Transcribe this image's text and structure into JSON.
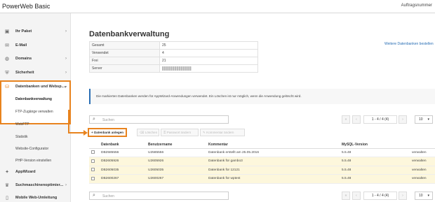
{
  "app": {
    "title": "PowerWeb Basic",
    "order_label": "Auftragsnummer"
  },
  "sidebar": {
    "items": [
      {
        "icon": "package-icon",
        "label": "Ihr Paket"
      },
      {
        "icon": "mail-icon",
        "label": "E-Mail"
      },
      {
        "icon": "globe-icon",
        "label": "Domains"
      },
      {
        "icon": "shield-icon",
        "label": "Sicherheit"
      },
      {
        "icon": "database-icon",
        "label": "Datenbanken und Websp..."
      },
      {
        "icon": "wizard-icon",
        "label": "AppWizard"
      },
      {
        "icon": "trophy-icon",
        "label": "Suchmaschinenoptimier..."
      },
      {
        "icon": "mobile-icon",
        "label": "Mobile Web-Umleitung"
      }
    ],
    "sub_items": [
      "Datenbankverwaltung",
      "FTP-Zugänge verwalten",
      "WebFTP",
      "Statistik",
      "Website-Configurator",
      "PHP-Version einstellen"
    ]
  },
  "main": {
    "title": "Datenbankverwaltung",
    "more_link": "Weitere Datenbanken bestellen",
    "stats": [
      {
        "label": "Gesamt",
        "value": "25"
      },
      {
        "label": "Verwendet",
        "value": "4"
      },
      {
        "label": "Frei",
        "value": "21"
      },
      {
        "label": "Server",
        "value": ""
      }
    ],
    "notice": "Die markierten Datenbanken werden für AppWizard-Anwendungen verwendet. Ein Löschen ist nur möglich, wenn die Anwendung gelöscht wird.",
    "search_placeholder": "Suchen",
    "pager_info": "1 - 4 / 4 (4)",
    "page_size": "10",
    "actions": {
      "create": "Datenbank anlegen",
      "delete": "Löschen",
      "reset_password": "Passwort ändern",
      "edit_comment": "Kommentar ändern"
    },
    "table": {
      "columns": [
        "",
        "Datenbank",
        "Benutzername",
        "Kommentar",
        "MySQL-Version",
        ""
      ],
      "rows": [
        {
          "db": "DB2585556",
          "user": "U2585556",
          "comment": "Datenbank erstellt am 25.05.2016",
          "version": "5.5.48",
          "action": "verwalten",
          "highlight": false
        },
        {
          "db": "DB2605926",
          "user": "U2605926",
          "comment": "Datenbank für gambo3",
          "version": "5.5.48",
          "action": "verwalten",
          "highlight": true
        },
        {
          "db": "DB2605035",
          "user": "U2605035",
          "comment": "Datenbank für 12121",
          "version": "5.5.48",
          "action": "verwalten",
          "highlight": true
        },
        {
          "db": "DB2600267",
          "user": "U2600267",
          "comment": "Datenbank für wptest",
          "version": "5.5.48",
          "action": "verwalten",
          "highlight": true
        }
      ]
    }
  },
  "colors": {
    "accent": "#e8831e",
    "link": "#2a6fb5",
    "highlight_row": "#fdf7dc"
  }
}
